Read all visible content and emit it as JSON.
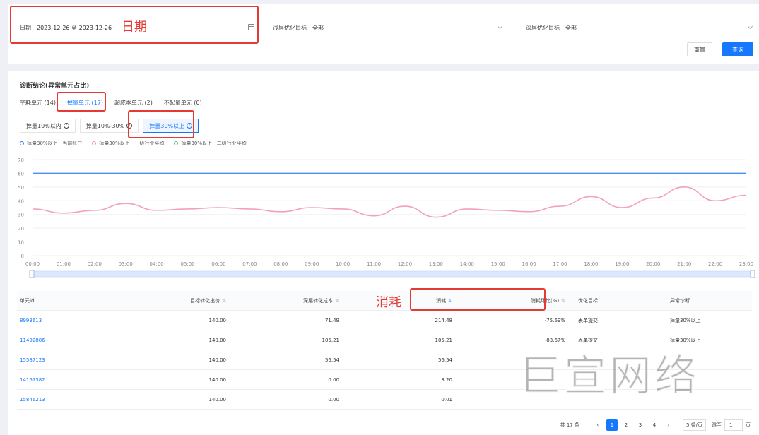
{
  "filters": {
    "date_label": "日期",
    "date_value": "2023-12-26 至 2023-12-26",
    "shallow_label": "浅层优化目标",
    "shallow_value": "全部",
    "deep_label": "深层优化目标",
    "deep_value": "全部",
    "reset_label": "重置",
    "query_label": "查询"
  },
  "annotations": {
    "date": "日期",
    "spend": "消耗"
  },
  "section": {
    "title": "诊断结论(异常单元占比)",
    "tabs": [
      {
        "label": "空耗单元 (14)"
      },
      {
        "label": "掉量单元 (17)"
      },
      {
        "label": "超成本单元 (2)"
      },
      {
        "label": "不起量单元 (0)"
      }
    ],
    "subtabs": [
      {
        "label": "掉量10%以内"
      },
      {
        "label": "掉量10%-30%"
      },
      {
        "label": "掉量30%以上"
      }
    ]
  },
  "legend": [
    {
      "label": "掉量30%以上 · 当前账户",
      "color": "#2f7ff0"
    },
    {
      "label": "掉量30%以上 · 一级行业平均",
      "color": "#f08cb4"
    },
    {
      "label": "掉量30%以上 · 二级行业平均",
      "color": "#4bc27a"
    }
  ],
  "chart_data": {
    "type": "line",
    "x": [
      "00:00",
      "01:00",
      "02:00",
      "03:00",
      "04:00",
      "05:00",
      "06:00",
      "07:00",
      "08:00",
      "09:00",
      "10:00",
      "11:00",
      "12:00",
      "13:00",
      "14:00",
      "15:00",
      "16:00",
      "17:00",
      "18:00",
      "19:00",
      "20:00",
      "21:00",
      "22:00",
      "23:00"
    ],
    "ylim": [
      0,
      70
    ],
    "yticks": [
      0,
      10,
      20,
      30,
      40,
      50,
      60,
      70
    ],
    "series": [
      {
        "name": "掉量30%以上 · 当前账户",
        "color": "#4a8df5",
        "values": [
          60,
          60,
          60,
          60,
          60,
          60,
          60,
          60,
          60,
          60,
          60,
          60,
          60,
          60,
          60,
          60,
          60,
          60,
          60,
          60,
          60,
          60,
          60,
          60
        ]
      },
      {
        "name": "掉量30%以上 · 一级行业平均",
        "color": "#f2a0c0",
        "values": [
          34,
          31,
          33,
          38,
          33,
          34,
          35,
          34,
          32,
          35,
          34,
          29,
          36,
          28,
          34,
          33,
          32,
          36,
          43,
          35,
          42,
          50,
          40,
          44
        ]
      }
    ],
    "grid": true
  },
  "table": {
    "headers": [
      "单元id",
      "目标转化出价",
      "深层转化成本",
      "消耗",
      "消耗环比(%)",
      "优化目标",
      "异常诊断"
    ],
    "rows": [
      [
        "8993613",
        "140.00",
        "71.49",
        "214.48",
        "-75.69%",
        "表单提交",
        "掉量30%以上"
      ],
      [
        "11492886",
        "140.00",
        "105.21",
        "105.21",
        "-83.67%",
        "表单提交",
        "掉量30%以上"
      ],
      [
        "15587123",
        "140.00",
        "56.54",
        "56.54",
        "",
        "",
        ""
      ],
      [
        "14167382",
        "140.00",
        "0.00",
        "3.20",
        "",
        "",
        ""
      ],
      [
        "15846213",
        "140.00",
        "0.00",
        "0.01",
        "",
        "",
        ""
      ]
    ]
  },
  "pager": {
    "total": "共 17 条",
    "pages": [
      "1",
      "2",
      "3",
      "4"
    ],
    "page_size": "5 条/页",
    "jump_label": "跳至",
    "jump_value": "1",
    "page_suffix": "页"
  },
  "watermark": "巨宣网络"
}
